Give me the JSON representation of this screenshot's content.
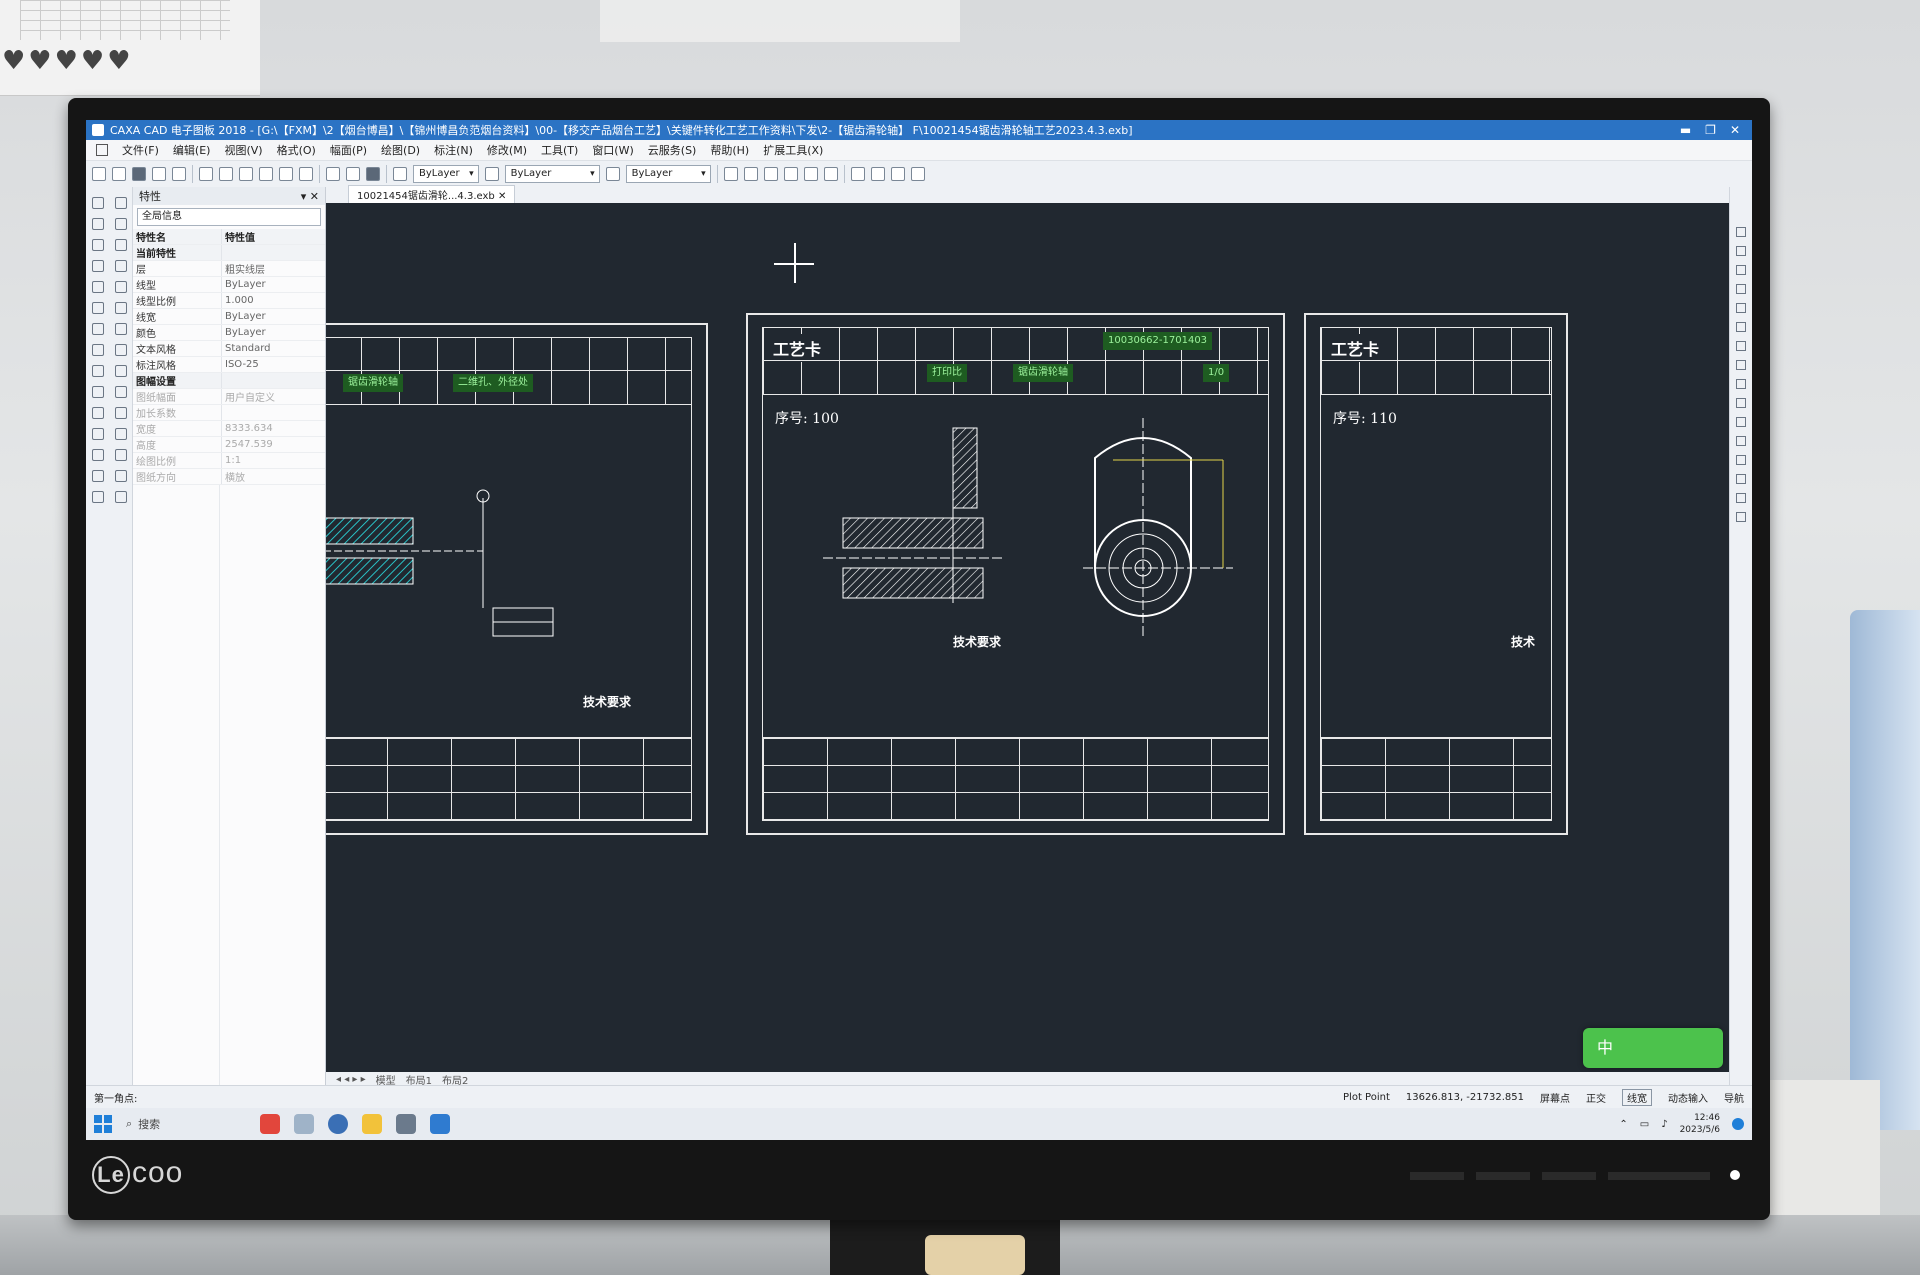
{
  "window": {
    "title": "CAXA CAD 电子图板 2018 - [G:\\【FXM】\\2【烟台博昌】\\【锦州博昌负范烟台资料】\\00-【移交产品烟台工艺】\\关键件转化工艺工作资料\\下发\\2-【锯齿滑轮轴】 F\\10021454锯齿滑轮轴工艺2023.4.3.exb]",
    "minimize": "▬",
    "maximize": "❐",
    "close": "✕"
  },
  "menu": [
    "文件(F)",
    "编辑(E)",
    "视图(V)",
    "格式(O)",
    "幅面(P)",
    "绘图(D)",
    "标注(N)",
    "修改(M)",
    "工具(T)",
    "窗口(W)",
    "云服务(S)",
    "帮助(H)",
    "扩展工具(X)"
  ],
  "toolbar": {
    "layer_combo": "ByLayer",
    "linetype_combo": "ByLayer",
    "lineweight_combo": "ByLayer"
  },
  "properties": {
    "header": "特性",
    "scope": "全局信息",
    "col_name": "特性名",
    "col_value": "特性值",
    "rows": [
      {
        "k": "当前特性",
        "v": "",
        "group": true
      },
      {
        "k": "层",
        "v": "粗实线层"
      },
      {
        "k": "线型",
        "v": "ByLayer"
      },
      {
        "k": "线型比例",
        "v": "1.000"
      },
      {
        "k": "线宽",
        "v": "ByLayer"
      },
      {
        "k": "颜色",
        "v": "ByLayer"
      },
      {
        "k": "文本风格",
        "v": "Standard"
      },
      {
        "k": "标注风格",
        "v": "ISO-25"
      },
      {
        "k": "图幅设置",
        "v": "",
        "group": true
      },
      {
        "k": "图纸幅面",
        "v": "用户自定义",
        "dim": true
      },
      {
        "k": "加长系数",
        "v": "",
        "dim": true
      },
      {
        "k": "宽度",
        "v": "8333.634",
        "dim": true
      },
      {
        "k": "高度",
        "v": "2547.539",
        "dim": true
      },
      {
        "k": "绘图比例",
        "v": "1:1",
        "dim": true
      },
      {
        "k": "图纸方向",
        "v": "横放",
        "dim": true
      }
    ]
  },
  "document_tab": "10021454锯齿滑轮...4.3.exb",
  "layout_tabs": [
    "模型",
    "布局1",
    "布局2"
  ],
  "sheets": {
    "left": {
      "green_cells": [
        "锯齿滑轮轴",
        "二维孔、外径处"
      ],
      "tech_title": "技术要求"
    },
    "center": {
      "logo": "工艺卡",
      "seq": "序号: 100",
      "green_cells": [
        "打印比",
        "锯齿滑轮轴",
        "1/0"
      ],
      "part_no": "10030662-1701403",
      "tech_title": "技术要求"
    },
    "right": {
      "logo": "工艺卡",
      "seq": "序号: 110",
      "tech_title": "技术"
    }
  },
  "ime_badge": "中",
  "status": {
    "prompt": "第一角点:",
    "plot_point": "Plot Point",
    "coords": "13626.813, -21732.851",
    "snap": "屏幕点",
    "mode1": "正交",
    "mode2": "线宽",
    "mode3": "动态输入",
    "mode4": "导航"
  },
  "taskbar": {
    "search": "搜索",
    "time": "12:46",
    "date": "2023/5/6"
  },
  "monitor": {
    "brand": "coo",
    "brand_mark": "Le"
  },
  "colors": {
    "titlebar": "#2b73c4",
    "canvas": "#212830",
    "ime": "#4cc24c"
  }
}
